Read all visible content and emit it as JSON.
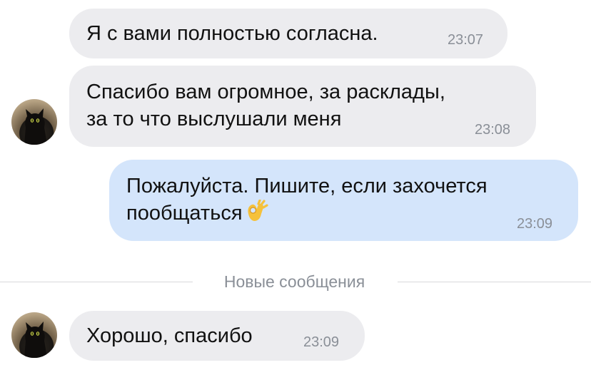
{
  "messages": [
    {
      "text": "Я с вами полностью согласна.",
      "time": "23:07",
      "direction": "incoming"
    },
    {
      "text": "Спасибо вам огромное, за расклады,\nза то что выслушали меня",
      "time": "23:08",
      "direction": "incoming"
    },
    {
      "text": "Пожалуйста.  Пишите, если захочется\nпообщаться",
      "time": "23:09",
      "direction": "outgoing",
      "emoji": "ok-hand"
    },
    {
      "text": "Хорошо, спасибо",
      "time": "23:09",
      "direction": "incoming"
    }
  ],
  "divider": {
    "label": "Новые сообщения"
  },
  "colors": {
    "incoming_bubble": "#ececef",
    "outgoing_bubble": "#d4e5fb",
    "timestamp": "#8a8f97",
    "divider": "#d8d8dc"
  },
  "avatar_icon": "black-cat-avatar"
}
